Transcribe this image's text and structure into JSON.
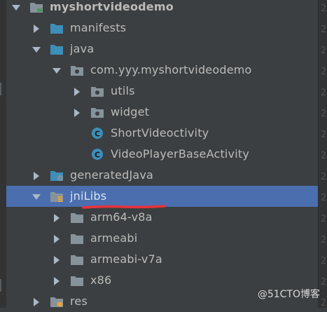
{
  "tree": [
    {
      "label": "myshortvideodemo",
      "depth": 0,
      "arrow": "down",
      "icon": "module-folder-icon",
      "bold": true
    },
    {
      "label": "manifests",
      "depth": 1,
      "arrow": "right",
      "icon": "folder-icon"
    },
    {
      "label": "java",
      "depth": 1,
      "arrow": "down",
      "icon": "folder-icon"
    },
    {
      "label": "com.yyy.myshortvideodemo",
      "depth": 2,
      "arrow": "down",
      "icon": "package-icon"
    },
    {
      "label": "utils",
      "depth": 3,
      "arrow": "right",
      "icon": "package-icon"
    },
    {
      "label": "widget",
      "depth": 3,
      "arrow": "right",
      "icon": "package-icon"
    },
    {
      "label": "ShortVideoctivity",
      "depth": 3,
      "arrow": "",
      "icon": "class-icon"
    },
    {
      "label": "VideoPlayerBaseActivity",
      "depth": 3,
      "arrow": "",
      "icon": "class-icon"
    },
    {
      "label": "generatedJava",
      "depth": 1,
      "arrow": "right",
      "icon": "generated-folder-icon"
    },
    {
      "label": "jniLibs",
      "depth": 1,
      "arrow": "down",
      "icon": "jnilibs-folder-icon",
      "selected": true
    },
    {
      "label": "arm64-v8a",
      "depth": 2,
      "arrow": "right",
      "icon": "folder-gray-icon"
    },
    {
      "label": "armeabi",
      "depth": 2,
      "arrow": "right",
      "icon": "folder-gray-icon"
    },
    {
      "label": "armeabi-v7a",
      "depth": 2,
      "arrow": "right",
      "icon": "folder-gray-icon"
    },
    {
      "label": "x86",
      "depth": 2,
      "arrow": "right",
      "icon": "folder-gray-icon"
    },
    {
      "label": "res",
      "depth": 1,
      "arrow": "right",
      "icon": "resources-folder-icon"
    }
  ],
  "gutter_numbers": [
    "2",
    "2",
    "2",
    "2",
    "2",
    "2",
    "2",
    "2",
    "2",
    "2",
    "2",
    "2",
    "2",
    "2",
    "2"
  ],
  "watermark": "@51CTO博客",
  "colors": {
    "background": "#3c3f41",
    "selection": "#4b6eaf",
    "annotation": "#e8323c",
    "class_icon": "#3d8eb9"
  }
}
